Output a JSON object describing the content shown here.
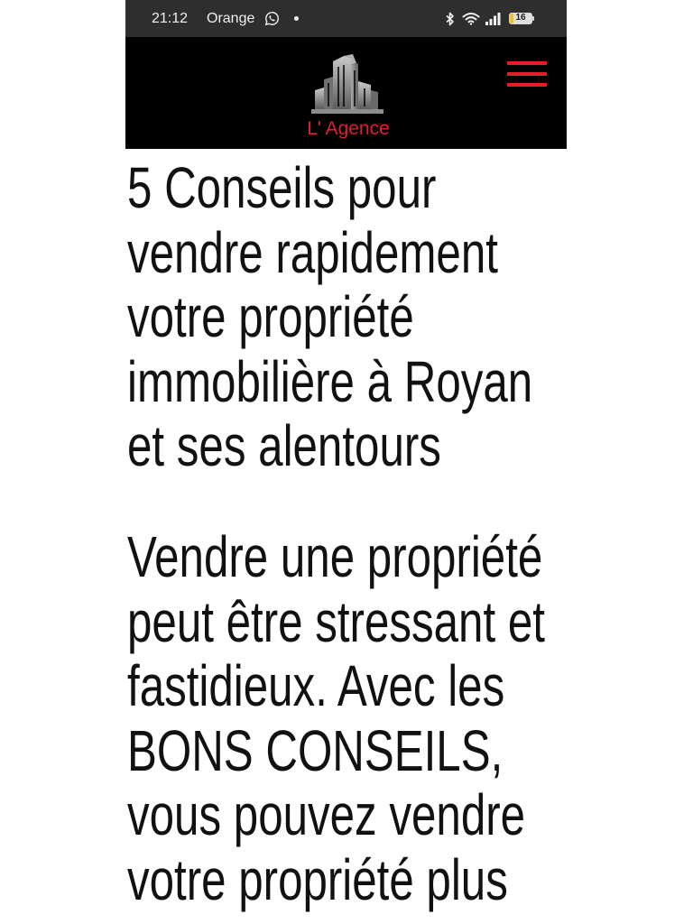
{
  "status_bar": {
    "time": "21:12",
    "carrier": "Orange",
    "battery": "16",
    "icons": [
      "whatsapp-icon",
      "notification-dot",
      "bluetooth-icon",
      "wifi-icon",
      "signal-icon",
      "battery-icon"
    ]
  },
  "header": {
    "logo_text": "L' Agence",
    "logo_icon": "buildings-logo-icon",
    "menu_icon": "hamburger-menu-icon"
  },
  "article": {
    "title_lines": [
      "5 Conseils pour",
      "vendre rapidement",
      "votre propriété",
      "immobilière à Royan",
      "et ses alentours"
    ],
    "intro_lines": [
      "Vendre une propriété",
      "peut être stressant et",
      "fastidieux. Avec les",
      "BONS CONSEILS,",
      "vous pouvez vendre",
      "votre propriété plus"
    ]
  },
  "colors": {
    "status_bar_bg": "#2e2e2e",
    "header_bg": "#000000",
    "accent": "#e3202a",
    "text": "#111111",
    "battery_fill": "#f0c419"
  }
}
